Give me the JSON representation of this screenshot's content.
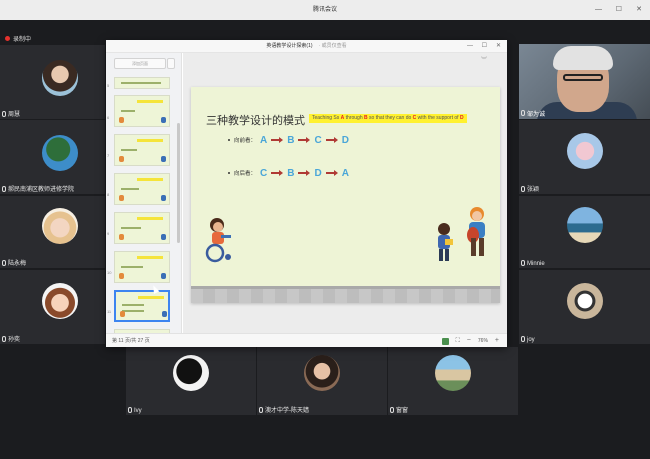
{
  "window": {
    "title": "腾讯会议"
  },
  "recording": {
    "label": "录制中",
    "color": "#e5322d"
  },
  "participants_left": [
    {
      "name": "周慧"
    },
    {
      "name": "郝民南浦区教师进修学院"
    },
    {
      "name": "陆永梅"
    },
    {
      "name": "孙奕"
    }
  ],
  "participants_right": [
    {
      "name": "邹为诚"
    },
    {
      "name": "张颖"
    },
    {
      "name": "Minnie"
    },
    {
      "name": "joy"
    }
  ],
  "participants_bottom": [
    {
      "name": "Ivy"
    },
    {
      "name": "澳才中学-陈天嫱"
    },
    {
      "name": "窗窗"
    }
  ],
  "ppt": {
    "title": "英语教学设计探索(1)",
    "subtitle": "· 或员仅查看",
    "thumb_button": "添加页面",
    "status_page": "第 11 页/共 27 页",
    "zoom": "76%",
    "slide": {
      "title": "三种教学设计的模式",
      "tag_parts": [
        "Teaching Ss ",
        "A",
        " through ",
        "B",
        " so that they can do ",
        "C",
        " with the support of ",
        "D"
      ],
      "rows": [
        {
          "label": "向前看：",
          "letters": [
            "A",
            "B",
            "C",
            "D"
          ]
        },
        {
          "label": "向后看：",
          "letters": [
            "C",
            "B",
            "D",
            "A"
          ]
        }
      ]
    },
    "thumb_numbers": [
      "5",
      "6",
      "7",
      "8",
      "9",
      "10",
      "11",
      "12"
    ]
  }
}
